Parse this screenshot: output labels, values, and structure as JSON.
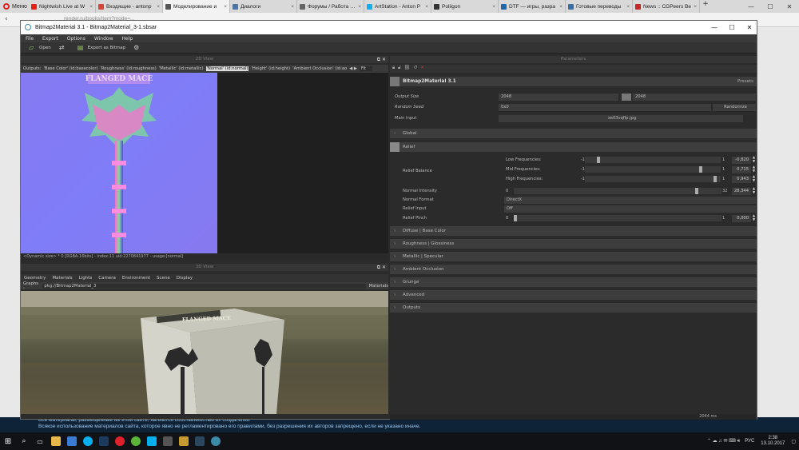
{
  "browser": {
    "menu_label": "Меню",
    "tabs": [
      {
        "title": "Nightwish Live at W",
        "color": "#e62117"
      },
      {
        "title": "Входящие - antonp",
        "color": "#d44638"
      },
      {
        "title": "Моделирование и",
        "color": "#555555",
        "active": true
      },
      {
        "title": "Диалоги",
        "color": "#4a76a8"
      },
      {
        "title": "Форумы / Работа / С",
        "color": "#666666"
      },
      {
        "title": "ArtStation - Anton P",
        "color": "#13aff0"
      },
      {
        "title": "Poliigon",
        "color": "#333333"
      },
      {
        "title": "DTF — игры, разра",
        "color": "#2266aa"
      },
      {
        "title": "Готовые переводы",
        "color": "#3a6ea5"
      },
      {
        "title": "News :: CGPeers Be",
        "color": "#c62828"
      }
    ],
    "tab_close": "×",
    "win_min": "—",
    "win_max": "☐",
    "win_close": "✕",
    "back_glyph": "‹",
    "url": "render.ru/books/item?mode=..."
  },
  "app": {
    "title": "Bitmap2Material 3.1 - Bitmap2Material_3-1.sbsar",
    "menu": [
      "File",
      "Export",
      "Options",
      "Window",
      "Help"
    ],
    "toolbar": {
      "open": "Open",
      "export": "Export as Bitmap"
    },
    "view2d": {
      "title": "2D View",
      "outputs_label": "Outputs:",
      "outputs": [
        "'Base Color' (id:basecolor)",
        "'Roughness' (id:roughness)",
        "'Metallic' (id:metallic)",
        "'Normal' (id:normal)",
        "'Height' (id:height)",
        "'Ambient Occlusion' (id:ao"
      ],
      "selected_output": "'Normal' (id:normal)",
      "fit": "Fit",
      "texture_label": "FLANGED MACE",
      "status": "<Dynamic size> * 0 [RGBA-16bits] - index:11 uid:2270841977 - usage:[normal]"
    },
    "view3d": {
      "title": "3D View",
      "tabs": [
        "Geometry",
        "Materials",
        "Lights",
        "Camera",
        "Environment",
        "Scene",
        "Display"
      ],
      "graphs_label": "Graphs :",
      "graphs_value": "pkg://Bitmap2Material_3",
      "materials_label": "Materials",
      "cube_label": "FLANGED MACE"
    },
    "params": {
      "title": "Parameters",
      "header": "Bitmap2Material 3.1",
      "presets": "Presets",
      "output_size_label": "Output Size",
      "output_size_w": "2048",
      "output_size_h": "2048",
      "random_seed_label": "Random Seed",
      "random_seed_value": "0x0",
      "randomize": "Randomize",
      "main_input_label": "Main Input",
      "main_input_value": "xe03vqflp.jpg",
      "sections_before": [
        "Global"
      ],
      "relief_title": "Relief",
      "relief_balance_label": "Relief Balance",
      "relief_balance": [
        {
          "label": "Low Frequencies:",
          "min": "-1",
          "max": "1",
          "value": "-0,820",
          "fraction": 0.09
        },
        {
          "label": "Mid Frequencies:",
          "min": "-1",
          "max": "1",
          "value": "0,715",
          "fraction": 0.86
        },
        {
          "label": "High Frequencies:",
          "min": "-1",
          "max": "1",
          "value": "0,943",
          "fraction": 0.97
        }
      ],
      "normal_intensity": {
        "label": "Normal Intensity",
        "min": "0",
        "max": "32",
        "value": "28,344",
        "fraction": 0.886
      },
      "normal_format": {
        "label": "Normal Format",
        "value": "DirectX"
      },
      "relief_input": {
        "label": "Relief Input",
        "value": "Off"
      },
      "relief_pinch": {
        "label": "Relief Pinch",
        "min": "0",
        "max": "1",
        "value": "0,000",
        "fraction": 0.0
      },
      "sections_after": [
        "Diffuse | Base Color",
        "Roughness | Glossiness",
        "Metallic | Specular",
        "Ambient Occlusion",
        "Grunge",
        "Advanced",
        "Outputs"
      ],
      "status": "2044 ms"
    }
  },
  "page_footer": {
    "line1": "Все материалы, размещенные на этом сайте, являются собственностью их создателей",
    "line2": "Всякое использование материалов сайта, которое явно не регламентировано его правилами, без разрешения их авторов запрещено, если не указано иначе."
  },
  "taskbar": {
    "lang": "РУС",
    "time": "2:38",
    "date": "13.10.2017"
  }
}
